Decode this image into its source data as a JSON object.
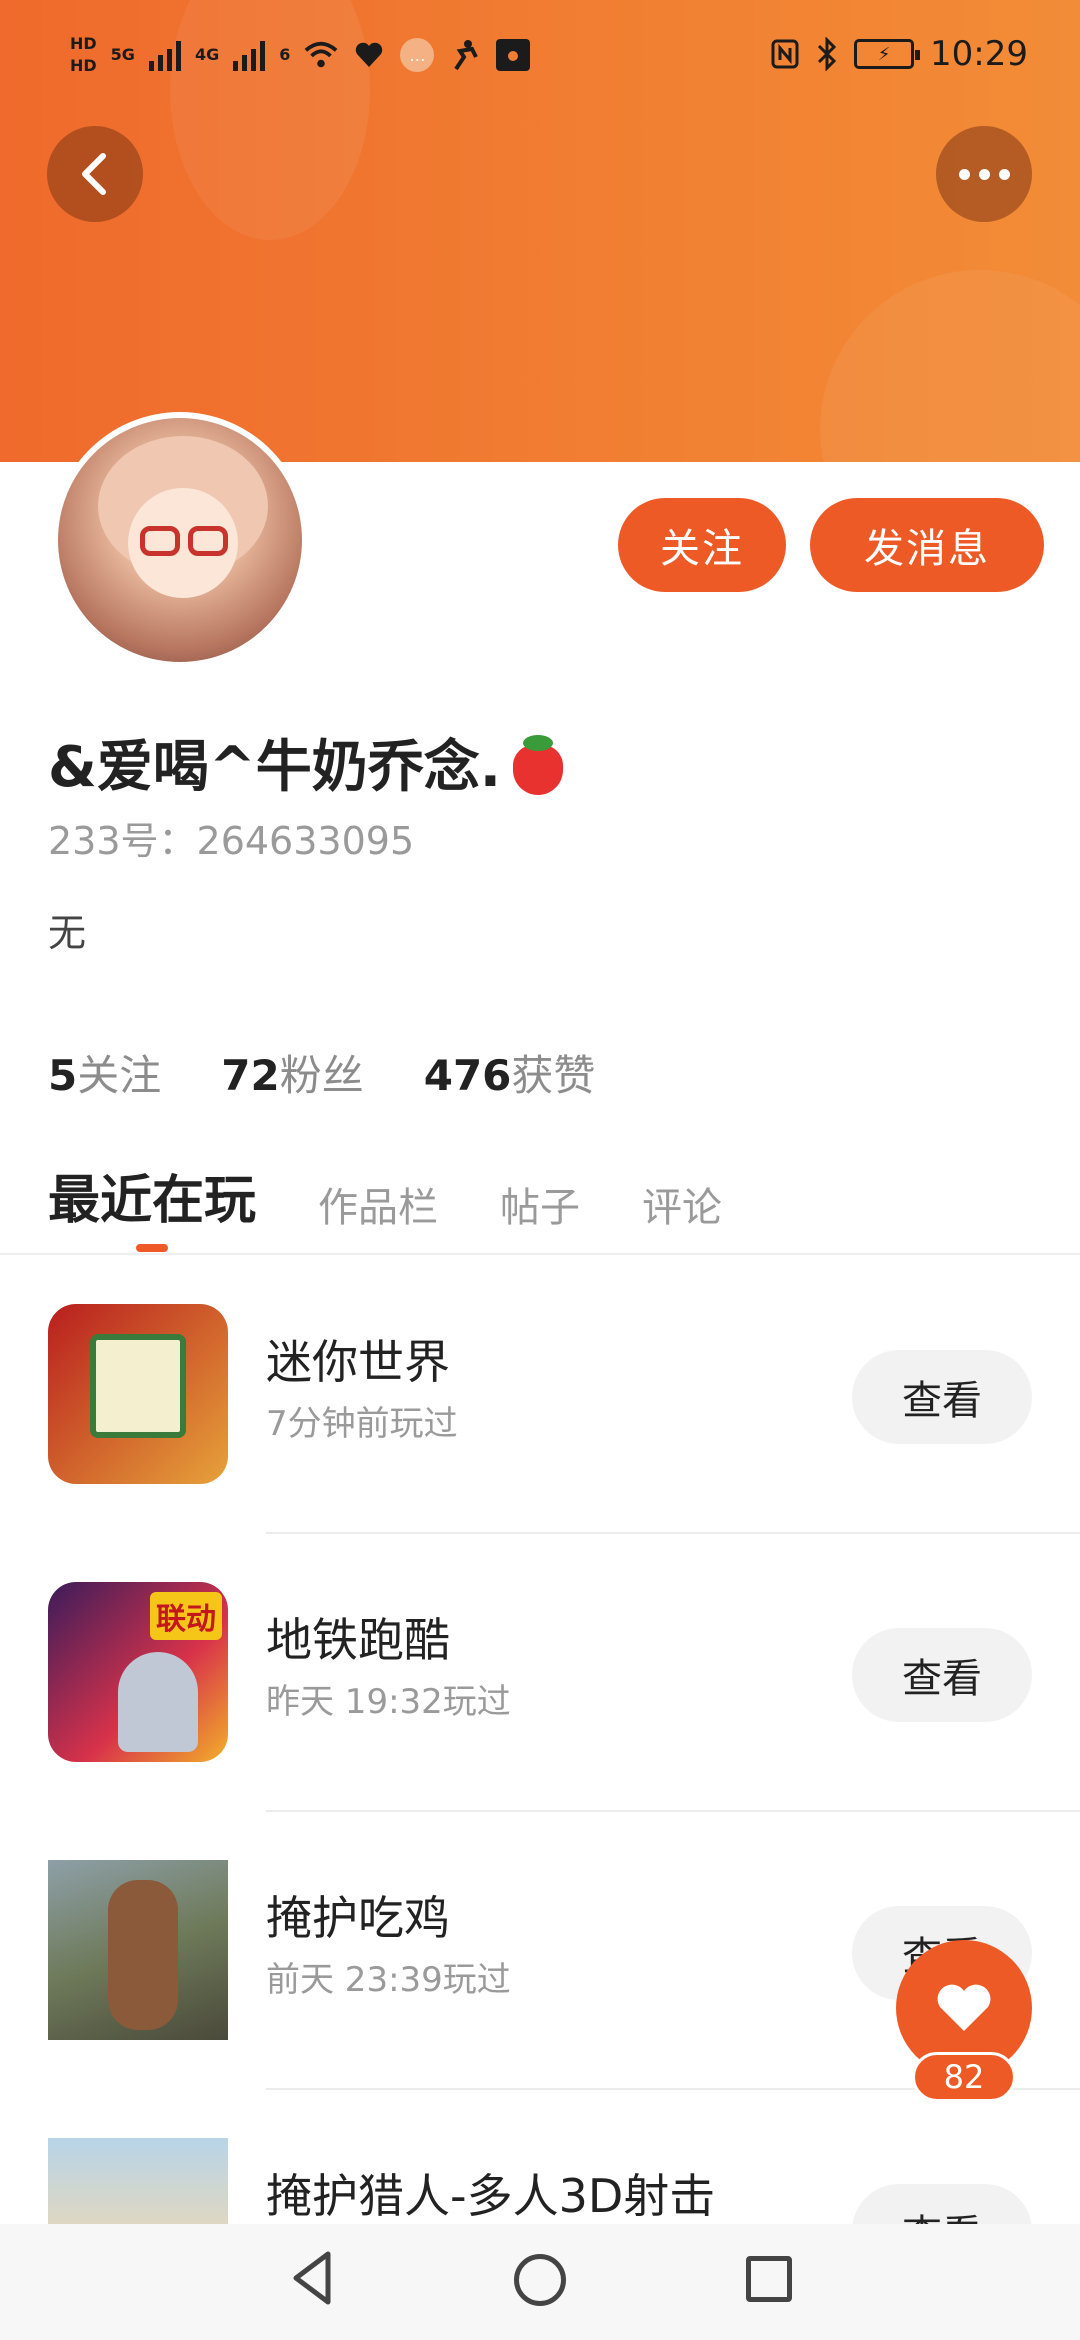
{
  "status_bar": {
    "hd1": "HD",
    "hd2": "HD",
    "net1": "5G",
    "net2": "4G",
    "net3": "6",
    "time": "10:29"
  },
  "profile": {
    "follow_label": "关注",
    "message_label": "发消息",
    "username": "&爱喝^牛奶乔念.",
    "uid": "233号：264633095",
    "bio": "无",
    "stats": [
      {
        "count": "5",
        "label": "关注"
      },
      {
        "count": "72",
        "label": "粉丝"
      },
      {
        "count": "476",
        "label": "获赞"
      }
    ]
  },
  "tabs": [
    {
      "label": "最近在玩"
    },
    {
      "label": "作品栏"
    },
    {
      "label": "帖子"
    },
    {
      "label": "评论"
    }
  ],
  "games": [
    {
      "name": "迷你世界",
      "time": "7分钟前玩过",
      "button": "查看"
    },
    {
      "name": "地铁跑酷",
      "time": "昨天 19:32玩过",
      "button": "查看",
      "badge": "联动"
    },
    {
      "name": "掩护吃鸡",
      "time": "前天 23:39玩过",
      "button": "查看"
    },
    {
      "name": "掩护猎人-多人3D射击",
      "time": "",
      "button": "查看"
    }
  ],
  "like_fab": {
    "count": "82"
  },
  "colors": {
    "accent": "#ee5a26",
    "header_start": "#ef6a2c",
    "header_end": "#f28c37"
  }
}
